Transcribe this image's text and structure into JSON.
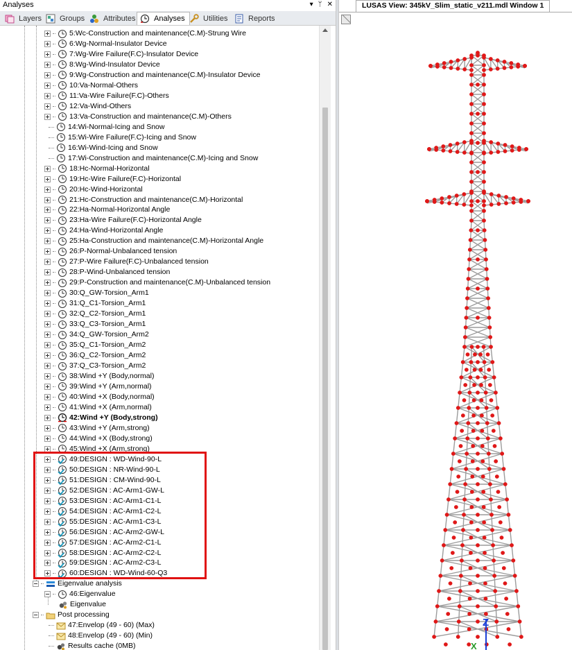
{
  "panel": {
    "title": "Analyses",
    "controls": [
      "▾",
      "ᛘ",
      "✕"
    ]
  },
  "tabs": [
    {
      "label": "Layers",
      "icon": "layers-icon",
      "active": false
    },
    {
      "label": "Groups",
      "icon": "groups-icon",
      "active": false
    },
    {
      "label": "Attributes",
      "icon": "attributes-icon",
      "active": false
    },
    {
      "label": "Analyses",
      "icon": "analyses-clock-icon",
      "active": true
    },
    {
      "label": "Utilities",
      "icon": "utilities-wrench-icon",
      "active": false
    },
    {
      "label": "Reports",
      "icon": "reports-icon",
      "active": false
    }
  ],
  "tree": {
    "loadcases": [
      {
        "label": "5:Wc-Construction and maintenance(C.M)-Strung Wire",
        "expandable": true
      },
      {
        "label": "6:Wg-Normal-Insulator Device",
        "expandable": true
      },
      {
        "label": "7:Wg-Wire Failure(F.C)-Insulator Device",
        "expandable": true
      },
      {
        "label": "8:Wg-Wind-Insulator Device",
        "expandable": true
      },
      {
        "label": "9:Wg-Construction and maintenance(C.M)-Insulator Device",
        "expandable": true
      },
      {
        "label": "10:Va-Normal-Others",
        "expandable": true
      },
      {
        "label": "11:Va-Wire Failure(F.C)-Others",
        "expandable": true
      },
      {
        "label": "12:Va-Wind-Others",
        "expandable": true
      },
      {
        "label": "13:Va-Construction and maintenance(C.M)-Others",
        "expandable": true
      },
      {
        "label": "14:Wi-Normal-Icing and Snow",
        "expandable": false
      },
      {
        "label": "15:Wi-Wire Failure(F.C)-Icing and Snow",
        "expandable": false
      },
      {
        "label": "16:Wi-Wind-Icing and Snow",
        "expandable": false
      },
      {
        "label": "17:Wi-Construction and maintenance(C.M)-Icing and Snow",
        "expandable": false
      },
      {
        "label": "18:Hc-Normal-Horizontal",
        "expandable": true
      },
      {
        "label": "19:Hc-Wire Failure(F.C)-Horizontal",
        "expandable": true
      },
      {
        "label": "20:Hc-Wind-Horizontal",
        "expandable": true
      },
      {
        "label": "21:Hc-Construction and maintenance(C.M)-Horizontal",
        "expandable": true
      },
      {
        "label": "22:Ha-Normal-Horizontal Angle",
        "expandable": true
      },
      {
        "label": "23:Ha-Wire Failure(F.C)-Horizontal Angle",
        "expandable": true
      },
      {
        "label": "24:Ha-Wind-Horizontal Angle",
        "expandable": true
      },
      {
        "label": "25:Ha-Construction and maintenance(C.M)-Horizontal Angle",
        "expandable": true
      },
      {
        "label": "26:P-Normal-Unbalanced tension",
        "expandable": true
      },
      {
        "label": "27:P-Wire Failure(F.C)-Unbalanced tension",
        "expandable": true
      },
      {
        "label": "28:P-Wind-Unbalanced tension",
        "expandable": true
      },
      {
        "label": "29:P-Construction and maintenance(C.M)-Unbalanced tension",
        "expandable": true
      },
      {
        "label": "30:Q_GW-Torsion_Arm1",
        "expandable": true
      },
      {
        "label": "31:Q_C1-Torsion_Arm1",
        "expandable": true
      },
      {
        "label": "32:Q_C2-Torsion_Arm1",
        "expandable": true
      },
      {
        "label": "33:Q_C3-Torsion_Arm1",
        "expandable": true
      },
      {
        "label": "34:Q_GW-Torsion_Arm2",
        "expandable": true
      },
      {
        "label": "35:Q_C1-Torsion_Arm2",
        "expandable": true
      },
      {
        "label": "36:Q_C2-Torsion_Arm2",
        "expandable": true
      },
      {
        "label": "37:Q_C3-Torsion_Arm2",
        "expandable": true
      },
      {
        "label": "38:Wind +Y (Body,normal)",
        "expandable": true
      },
      {
        "label": "39:Wind +Y (Arm,normal)",
        "expandable": true
      },
      {
        "label": "40:Wind +X (Body,normal)",
        "expandable": true
      },
      {
        "label": "41:Wind +X (Arm,normal)",
        "expandable": true
      },
      {
        "label": "42:Wind +Y (Body,strong)",
        "expandable": true,
        "active": true
      },
      {
        "label": "43:Wind +Y (Arm,strong)",
        "expandable": true
      },
      {
        "label": "44:Wind +X (Body,strong)",
        "expandable": true
      },
      {
        "label": "45:Wind +X (Arm,strong)",
        "expandable": true
      }
    ],
    "designs": [
      "49:DESIGN : WD-Wind-90-L",
      "50:DESIGN : NR-Wind-90-L",
      "51:DESIGN : CM-Wind-90-L",
      "52:DESIGN : AC-Arm1-GW-L",
      "53:DESIGN : AC-Arm1-C1-L",
      "54:DESIGN : AC-Arm1-C2-L",
      "55:DESIGN : AC-Arm1-C3-L",
      "56:DESIGN : AC-Arm2-GW-L",
      "57:DESIGN : AC-Arm2-C1-L",
      "58:DESIGN : AC-Arm2-C2-L",
      "59:DESIGN : AC-Arm2-C3-L",
      "60:DESIGN : WD-Wind-60-Q3"
    ],
    "eigen": {
      "group": "Eigenvalue analysis",
      "item": "46:Eigenvalue",
      "child": "Eigenvalue"
    },
    "post": {
      "group": "Post processing",
      "items": [
        "47:Envelop (49 - 60) (Max)",
        "48:Envelop (49 - 60) (Min)"
      ],
      "cache": "Results cache (0MB)"
    }
  },
  "view": {
    "tab_title": "LUSAS View: 345kV_Slim_static_v211.mdl Window 1",
    "axis_labels": {
      "z": "Z",
      "x": "X"
    },
    "colors": {
      "members": "#9c9c9c",
      "nodes": "#e01818",
      "axis_z": "#1a3fd6",
      "axis_x": "#2a9a2a"
    }
  }
}
